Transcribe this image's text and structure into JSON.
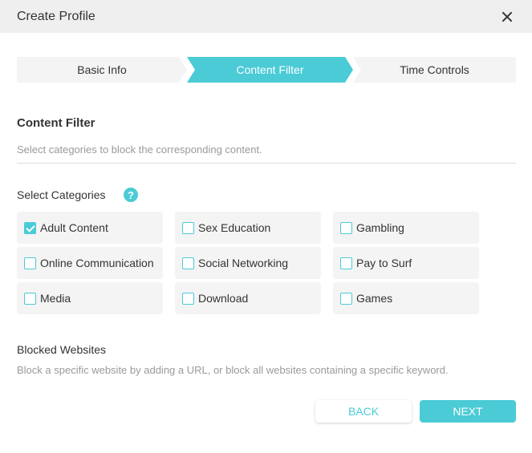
{
  "dialog": {
    "title": "Create Profile"
  },
  "steps": [
    {
      "label": "Basic Info",
      "active": false
    },
    {
      "label": "Content Filter",
      "active": true
    },
    {
      "label": "Time Controls",
      "active": false
    }
  ],
  "content_filter": {
    "title": "Content Filter",
    "description": "Select categories to block the corresponding content."
  },
  "categories": {
    "label": "Select Categories",
    "help_icon": "?",
    "items": [
      {
        "label": "Adult Content",
        "checked": true
      },
      {
        "label": "Sex Education",
        "checked": false
      },
      {
        "label": "Gambling",
        "checked": false
      },
      {
        "label": "Online Communication",
        "checked": false
      },
      {
        "label": "Social Networking",
        "checked": false
      },
      {
        "label": "Pay to Surf",
        "checked": false
      },
      {
        "label": "Media",
        "checked": false
      },
      {
        "label": "Download",
        "checked": false
      },
      {
        "label": "Games",
        "checked": false
      }
    ]
  },
  "blocked_websites": {
    "title": "Blocked Websites",
    "description": "Block a specific website by adding a URL, or block all websites containing a specific keyword."
  },
  "buttons": {
    "back": "BACK",
    "next": "NEXT"
  },
  "colors": {
    "accent": "#4acbd6",
    "header_bg": "#efeff0",
    "step_inactive": "#f4f4f4",
    "category_bg": "#f4f4f4"
  },
  "icons": {
    "close": "close-icon",
    "help": "question-icon",
    "check": "checkmark-icon"
  }
}
